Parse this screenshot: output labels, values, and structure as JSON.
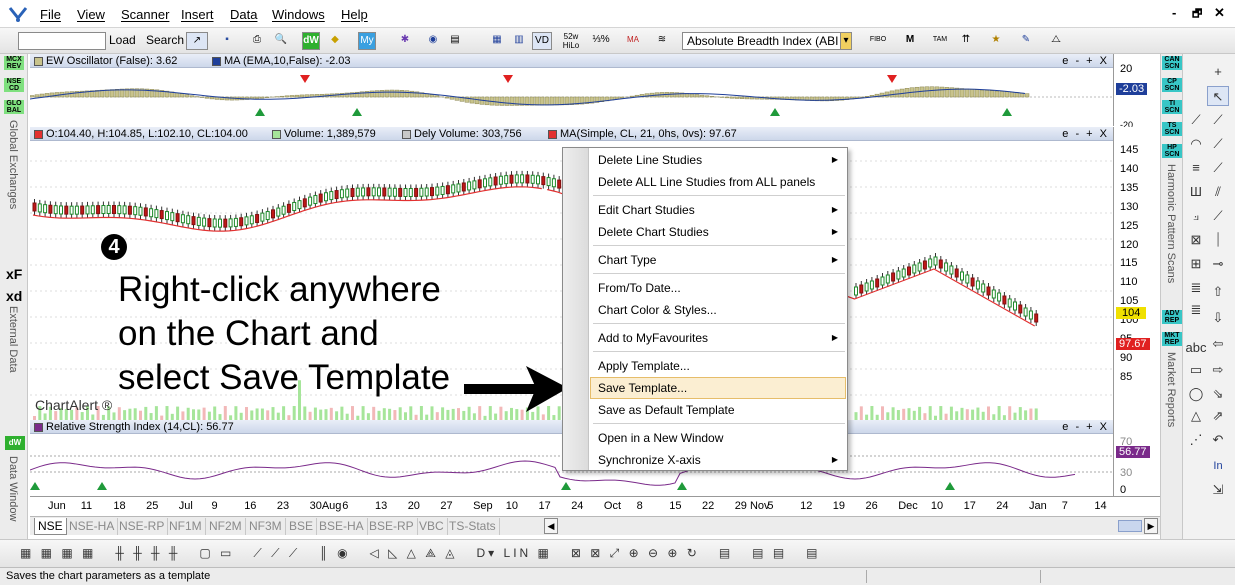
{
  "menu": {
    "items": [
      "File",
      "View",
      "Scanner",
      "Insert",
      "Data",
      "Windows",
      "Help"
    ]
  },
  "window_controls": [
    "-",
    "🗗",
    "✕"
  ],
  "toolbar": {
    "load": "Load",
    "search": "Search",
    "indicator_select": "Absolute Breadth Index (ABI",
    "label_52w": "52w\nHiLo"
  },
  "left_strip": {
    "badges": [
      {
        "text": "MCX\nREV",
        "color": "#7fe07f"
      },
      {
        "text": "NSE\nCD",
        "color": "#7fe07f"
      },
      {
        "text": "GLO\nBAL",
        "color": "#7fe07f"
      }
    ],
    "global_exchanges": "Global Exchanges",
    "xf": "xF",
    "xd": "xd",
    "external_data": "External Data",
    "dw_badge": "dW",
    "data_window": "Data Window"
  },
  "right_strip": {
    "badges": [
      {
        "text": "CAN\nSCN",
        "color": "#38c6c6"
      },
      {
        "text": "CP\nSCN",
        "color": "#38c6c6"
      },
      {
        "text": "TI\nSCN",
        "color": "#38c6c6"
      },
      {
        "text": "TS\nSCN",
        "color": "#38c6c6"
      },
      {
        "text": "HP\nSCN",
        "color": "#38c6c6"
      }
    ],
    "harmonic": "Harmonic Pattern Scans",
    "rep_badges": [
      {
        "text": "ADV\nREP",
        "color": "#38c6c6"
      },
      {
        "text": "MKT\nREP",
        "color": "#38c6c6"
      }
    ],
    "market_reports": "Market Reports"
  },
  "ew_panel": {
    "title": "EW Oscillator (False): 3.62",
    "ma": "MA (EMA,10,False): -2.03",
    "controls": "e - + X",
    "axis": [
      "20",
      "0",
      "-20"
    ],
    "axis_neg_label": "-2.03"
  },
  "price_panel": {
    "ohlc": "O:104.40, H:104.85, L:102.10, CL:104.00",
    "volume": "Volume: 1,389,579",
    "dely": "Dely Volume: 303,756",
    "ma": "MA(Simple, CL, 21, 0hs, 0vs): 97.67",
    "controls": "e - + X",
    "axis": [
      "145",
      "140",
      "135",
      "130",
      "125",
      "120",
      "115",
      "110",
      "105",
      "100",
      "95",
      "90",
      "85"
    ],
    "last_price": "104",
    "ma_value": "97.67",
    "step_number": "4",
    "brand": "ChartAlert ®"
  },
  "rsi_panel": {
    "title": "Relative Strength Index (14,CL): 56.77",
    "controls": "e - + X",
    "axis": [
      "70",
      "30",
      "0"
    ],
    "value": "56.77"
  },
  "x_axis": {
    "labels": [
      "Jun",
      "11",
      "18",
      "25",
      "Jul",
      "9",
      "16",
      "23",
      "30Aug",
      "6",
      "13",
      "20",
      "27",
      "Sep",
      "10",
      "17",
      "24",
      "Oct",
      "8",
      "15",
      "22",
      "29 Nov",
      "5",
      "12",
      "19",
      "26",
      "Dec",
      "10",
      "17",
      "24",
      "Jan",
      "7",
      "14"
    ]
  },
  "tabs": [
    "NSE",
    "NSE-HA",
    "NSE-RP",
    "NF1M",
    "NF2M",
    "NF3M",
    "BSE",
    "BSE-HA",
    "BSE-RP",
    "VBC",
    "TS-Stats"
  ],
  "context_menu": {
    "items": [
      {
        "label": "Delete Line Studies",
        "submenu": true
      },
      {
        "label": "Delete ALL Line Studies from ALL panels",
        "submenu": false
      },
      {
        "label": "Edit Chart Studies",
        "submenu": true
      },
      {
        "label": "Delete Chart Studies",
        "submenu": true
      },
      {
        "label": "Chart Type",
        "submenu": true
      },
      {
        "label": "From/To Date...",
        "submenu": false
      },
      {
        "label": "Chart Color & Styles...",
        "submenu": false
      },
      {
        "label": "Add to MyFavourites",
        "submenu": true
      },
      {
        "label": "Apply Template...",
        "submenu": false
      },
      {
        "label": "Save Template...",
        "submenu": false,
        "highlighted": true
      },
      {
        "label": "Save as Default Template",
        "submenu": false
      },
      {
        "label": "Open in a New Window",
        "submenu": false
      },
      {
        "label": "Synchronize X-axis",
        "submenu": true
      }
    ]
  },
  "annotation": {
    "line1": "Right-click anywhere",
    "line2": "on the Chart and",
    "line3": "select Save Template"
  },
  "status": {
    "text": "Saves the chart parameters as a template"
  },
  "colors": {
    "accent": "#1f3f9a",
    "ma_line": "#e23030",
    "rsi": "#7a2a8a",
    "volume": "#a6e59a",
    "hist": "#c8c38c"
  }
}
